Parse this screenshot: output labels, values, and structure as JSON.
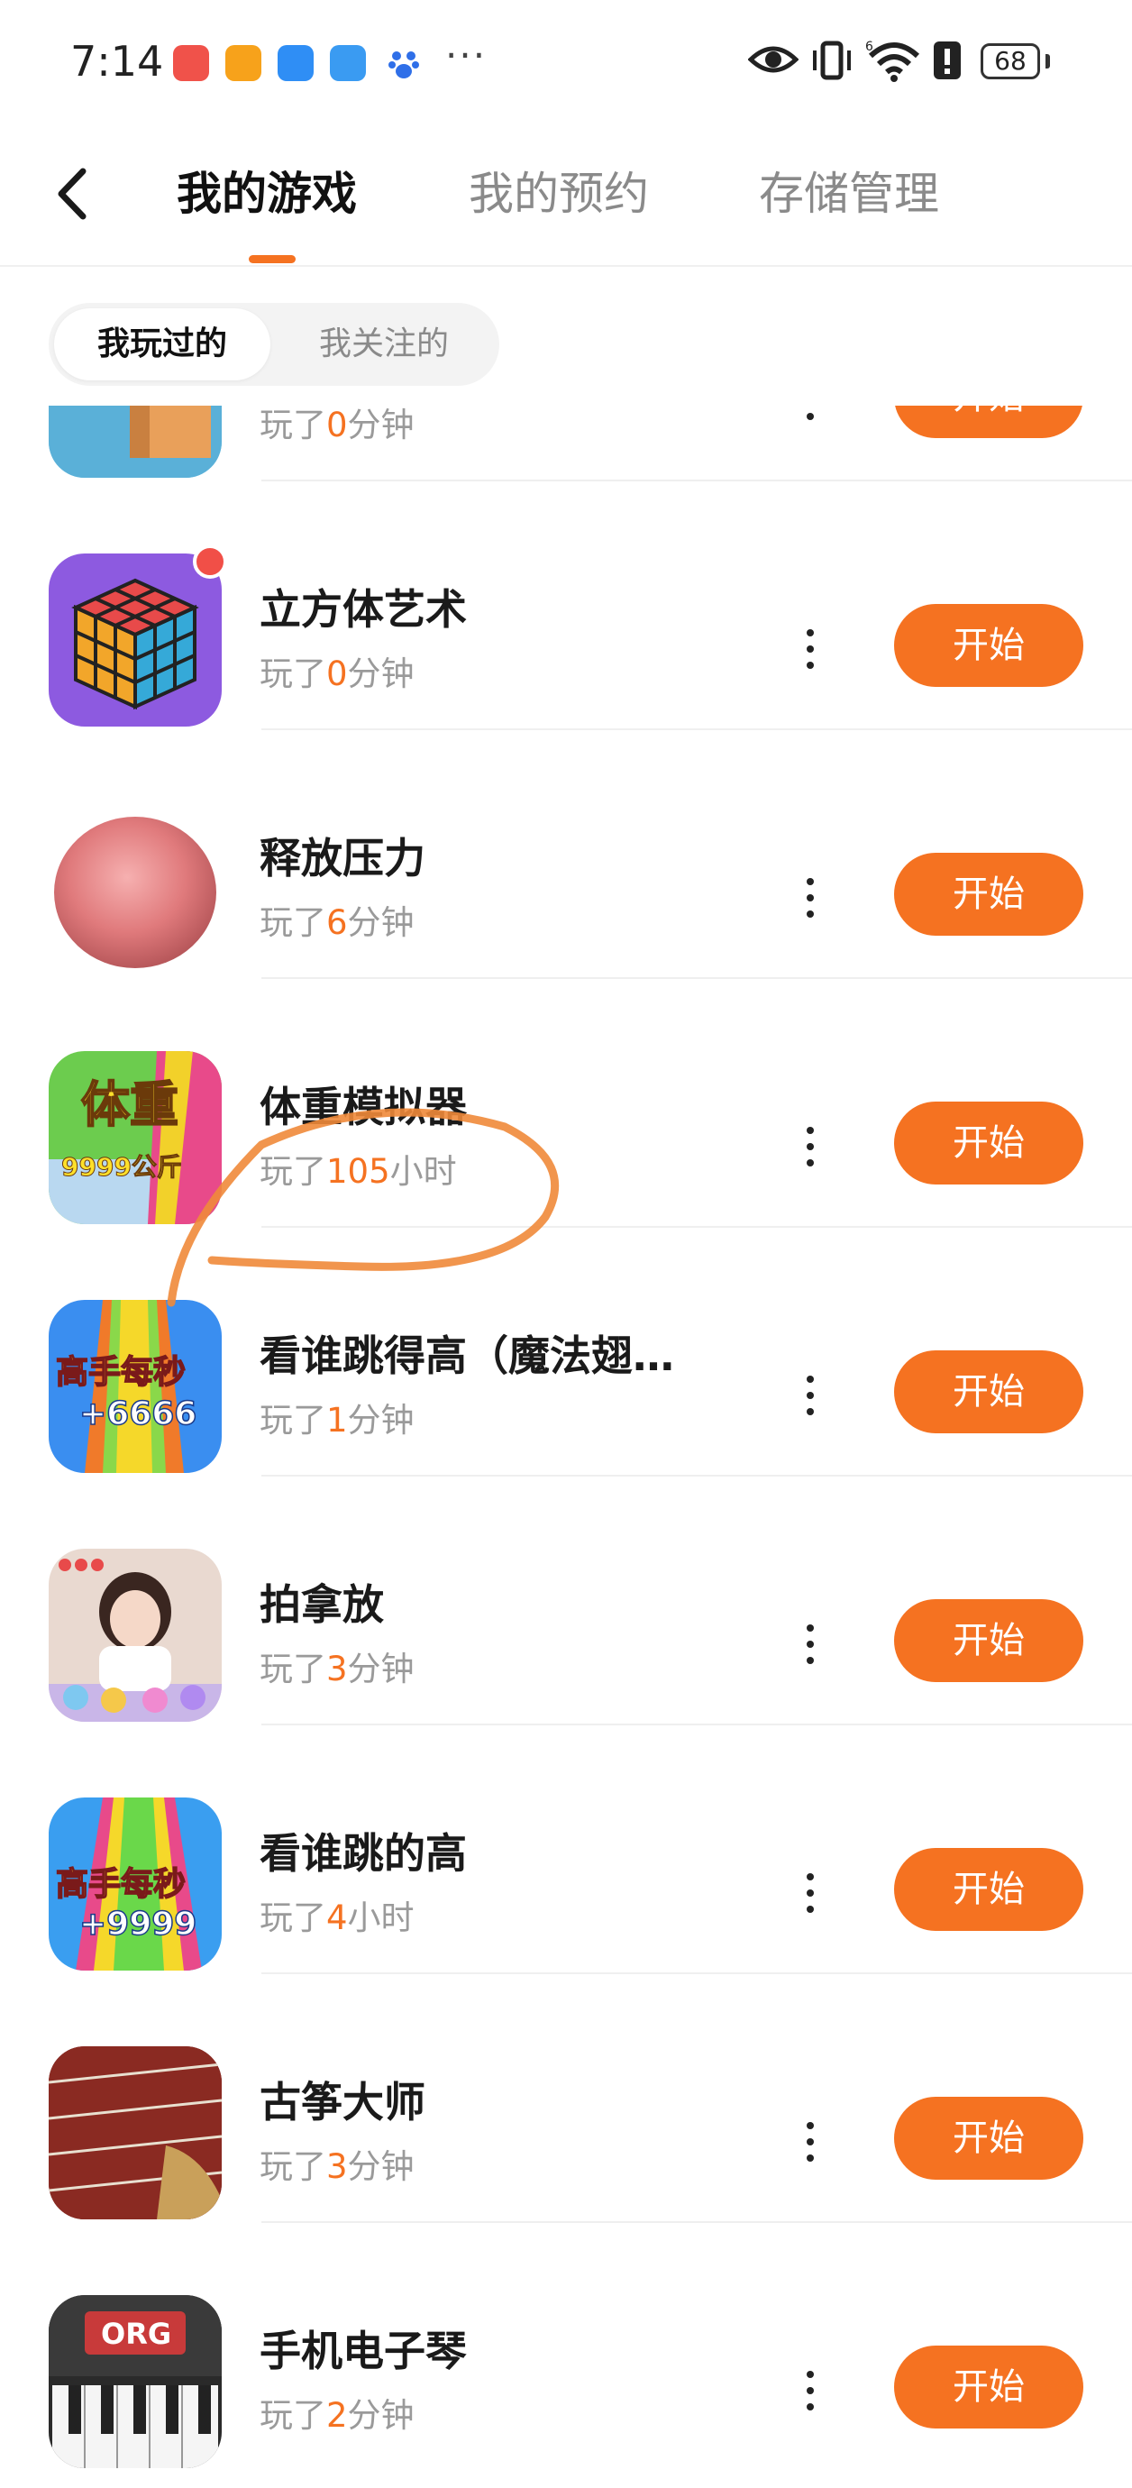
{
  "status_bar": {
    "time": "7:14",
    "more": "···",
    "battery": "68",
    "icons": [
      "app-icon-kuaishou",
      "app-icon-video",
      "cloud-icon",
      "weather-icon",
      "baidu-icon",
      "eye-icon",
      "vibrate-icon",
      "wifi-icon",
      "alert-icon",
      "battery-icon"
    ]
  },
  "header": {
    "back_icon": "chevron-left-icon",
    "tabs": [
      {
        "label": "我的游戏"
      },
      {
        "label": "我的预约"
      },
      {
        "label": "存储管理"
      }
    ]
  },
  "filter": {
    "options": [
      {
        "label": "我玩过的"
      },
      {
        "label": "我关注的"
      }
    ]
  },
  "colors": {
    "accent": "#f57221",
    "badge": "#f14f47"
  },
  "games": [
    {
      "title": "",
      "played_prefix": "玩了",
      "played_num": "0",
      "played_unit": "分钟",
      "button": "开始"
    },
    {
      "title": "立方体艺术",
      "played_prefix": "玩了",
      "played_num": "0",
      "played_unit": "分钟",
      "button": "开始"
    },
    {
      "title": "释放压力",
      "played_prefix": "玩了",
      "played_num": "6",
      "played_unit": "分钟",
      "button": "开始"
    },
    {
      "title": "体重模拟器",
      "played_prefix": "玩了",
      "played_num": "105",
      "played_unit": "小时",
      "button": "开始",
      "icon_text": [
        "体重",
        "9999公斤"
      ]
    },
    {
      "title": "看谁跳得高（魔法翅…",
      "played_prefix": "玩了",
      "played_num": "1",
      "played_unit": "分钟",
      "button": "开始",
      "icon_text": [
        "高手每秒",
        "+6666"
      ]
    },
    {
      "title": "拍拿放",
      "played_prefix": "玩了",
      "played_num": "3",
      "played_unit": "分钟",
      "button": "开始"
    },
    {
      "title": "看谁跳的高",
      "played_prefix": "玩了",
      "played_num": "4",
      "played_unit": "小时",
      "button": "开始",
      "icon_text": [
        "高手每秒",
        "+9999"
      ]
    },
    {
      "title": "古筝大师",
      "played_prefix": "玩了",
      "played_num": "3",
      "played_unit": "分钟",
      "button": "开始"
    },
    {
      "title": "手机电子琴",
      "played_prefix": "玩了",
      "played_num": "2",
      "played_unit": "分钟",
      "button": "开始",
      "icon_text": [
        "ORG"
      ]
    }
  ]
}
